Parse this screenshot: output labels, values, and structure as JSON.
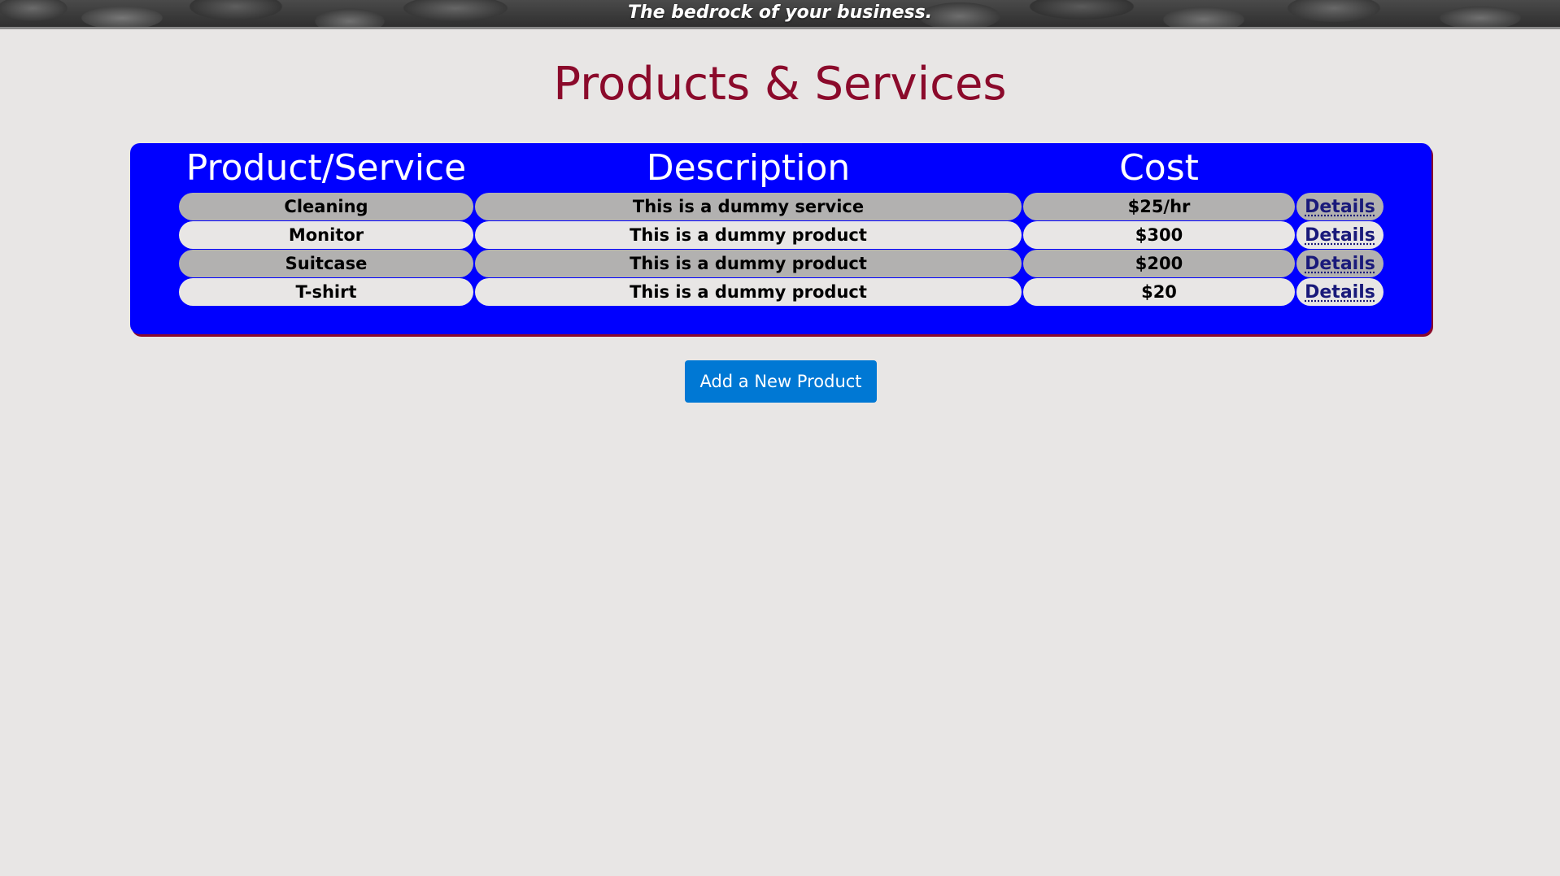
{
  "header": {
    "tagline": "The bedrock of your business."
  },
  "page": {
    "title": "Products & Services"
  },
  "table": {
    "columns": [
      "Product/Service",
      "Description",
      "Cost"
    ],
    "rows": [
      {
        "name": "Cleaning",
        "description": "This is a dummy service",
        "cost": "$25/hr",
        "link": "Details"
      },
      {
        "name": "Monitor",
        "description": "This is a dummy product",
        "cost": "$300",
        "link": "Details"
      },
      {
        "name": "Suitcase",
        "description": "This is a dummy product",
        "cost": "$200",
        "link": "Details"
      },
      {
        "name": "T-shirt",
        "description": "This is a dummy product",
        "cost": "$20",
        "link": "Details"
      }
    ]
  },
  "actions": {
    "add_label": "Add a New Product"
  },
  "colors": {
    "title": "#8b0a2b",
    "panel": "#0000ff",
    "button": "#0078d4",
    "row_dark": "#b2b1b0",
    "row_light": "#e8e6e5",
    "page_bg": "#e8e6e5"
  }
}
